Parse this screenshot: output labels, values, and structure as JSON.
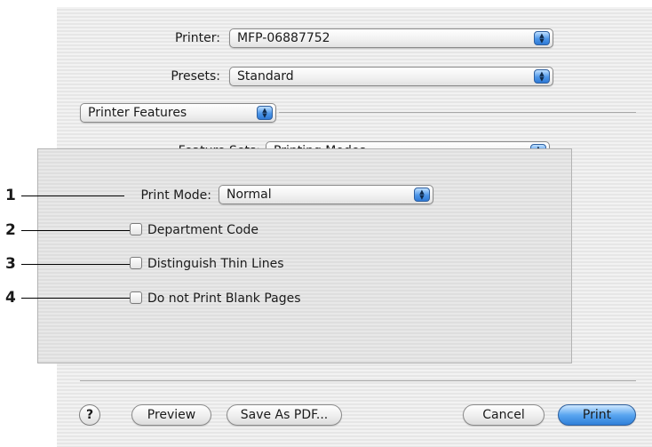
{
  "printer": {
    "label": "Printer:",
    "value": "MFP-06887752"
  },
  "presets": {
    "label": "Presets:",
    "value": "Standard"
  },
  "panel_menu": {
    "value": "Printer Features"
  },
  "feature_sets": {
    "label": "Feature Sets:",
    "value": "Printing Modes"
  },
  "print_mode": {
    "label": "Print Mode:",
    "value": "Normal"
  },
  "options": [
    {
      "label": "Department Code",
      "checked": false
    },
    {
      "label": "Distinguish Thin Lines",
      "checked": false
    },
    {
      "label": "Do not Print Blank Pages",
      "checked": false
    }
  ],
  "callouts": [
    "1",
    "2",
    "3",
    "4"
  ],
  "buttons": {
    "help": "?",
    "preview": "Preview",
    "save_pdf": "Save As PDF...",
    "cancel": "Cancel",
    "print": "Print"
  },
  "icons": {
    "popup_arrows": "up-down-arrows-icon",
    "help": "question-mark-icon"
  },
  "colors": {
    "accent": "#4d96e8",
    "dialog_bg": "#ececec"
  }
}
